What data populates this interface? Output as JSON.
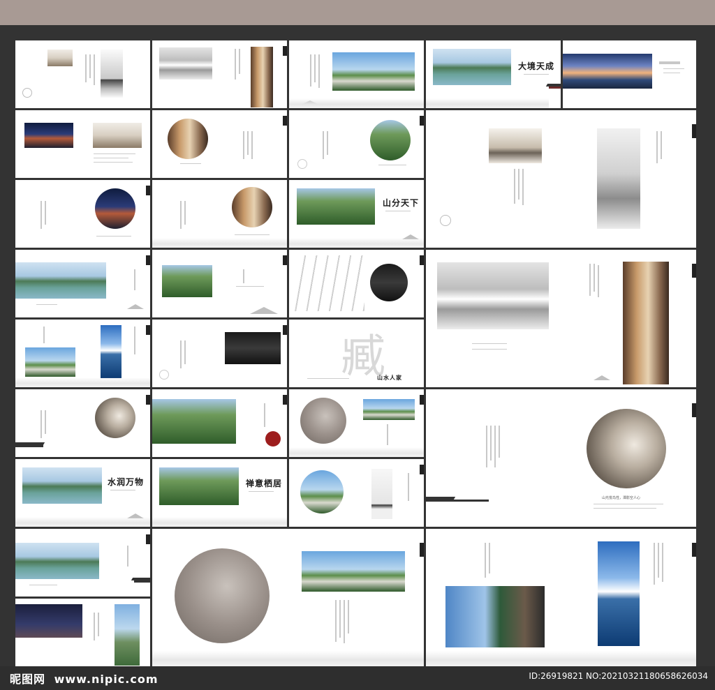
{
  "watermark": {
    "site_logo": "昵图网",
    "url": "www.nipic.com"
  },
  "footer": {
    "id_info": "ID:26919821 NO:20210321180658626034"
  },
  "calligraphy": {
    "t1": "大境天成",
    "t2": "山分天下",
    "t3": "水润万物",
    "t4": "禅意栖居",
    "t5": "臧",
    "t6": "山水人家"
  },
  "captions": {
    "c1": "山光悦鸟性，潭影空人心"
  },
  "colors": {
    "background": "#333333",
    "topbar": "#a89a94",
    "page": "#ffffff"
  }
}
